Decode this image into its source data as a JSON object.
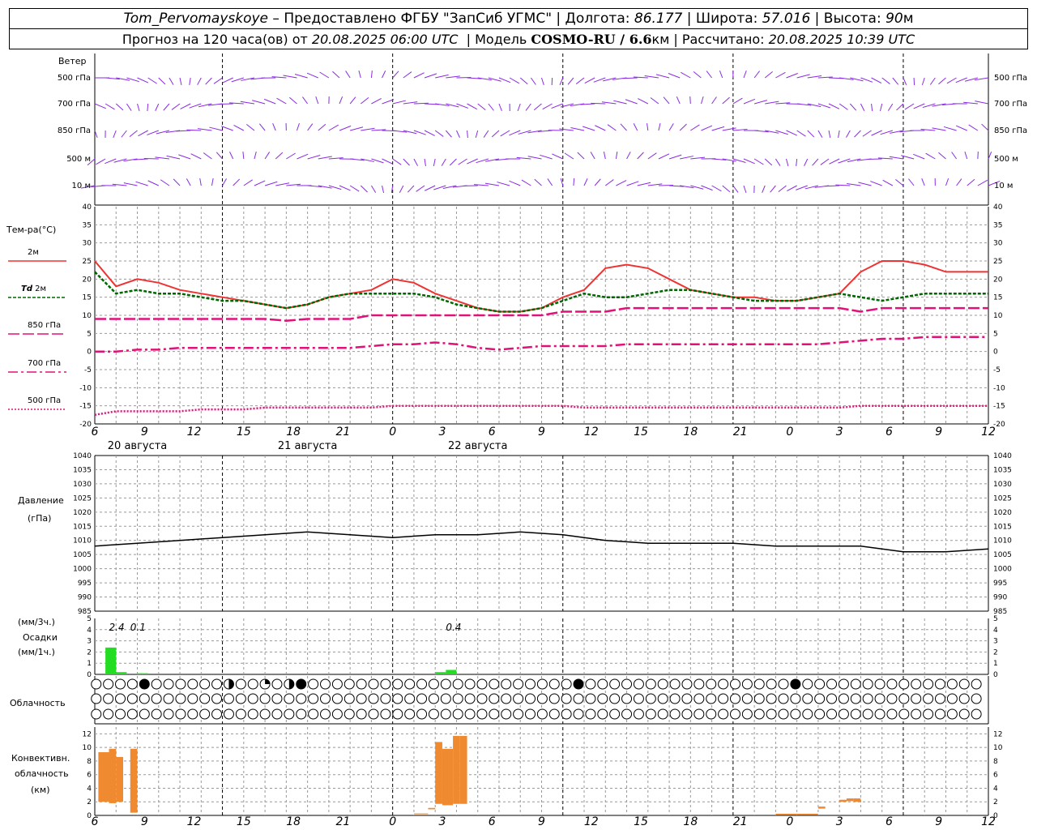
{
  "header": {
    "station": "Tom_Pervomayskoye",
    "provider": " – Предоставлено ФГБУ \"ЗапСиб УГМС\" | ",
    "lon_label": "Долгота: ",
    "lon": "86.177",
    "lat_label": " | Широта: ",
    "lat": "57.016",
    "alt_label": " | Высота: ",
    "alt": "90",
    "alt_unit": "м",
    "forecast_label": "Прогноз на 120 часа(ов) от ",
    "forecast_from": "20.08.2025 06:00 UTC",
    "model_label": "  | Модель ",
    "model": "COSMO-RU / 6.6",
    "model_unit": "км",
    "calc_label": " | Рассчитано: ",
    "calc_time": "20.08.2025 10:39 UTC"
  },
  "colors": {
    "wind": "#8a2be2",
    "t2m": "#ee3333",
    "td2m": "#006600",
    "t850": "#e0127a",
    "t700": "#e0127a",
    "t500": "#e0127a",
    "pressure": "#000000",
    "precip": "#22dd22",
    "conv": "#f08a30"
  },
  "wind_panel": {
    "title": "Ветер",
    "levels": [
      "500 гПа",
      "700 гПа",
      "850 гПа",
      "500 м",
      "10 м"
    ]
  },
  "temp_panel": {
    "title": "Тем-ра(°C)",
    "legend": [
      {
        "key": "t2m",
        "label": "2м"
      },
      {
        "key": "td2m",
        "label_bold": "Td",
        "label": " 2м"
      },
      {
        "key": "t850",
        "label": "850 гПа"
      },
      {
        "key": "t700",
        "label": "700 гПа"
      },
      {
        "key": "t500",
        "label": "500 гПа"
      }
    ]
  },
  "pressure_panel": {
    "title1": "Давление",
    "title2": "(гПа)"
  },
  "precip_panel": {
    "title1": "(мм/3ч.)",
    "title2": "Осадки",
    "title3": "(мм/1ч.)"
  },
  "cloud_panel": {
    "title": "Облачность"
  },
  "conv_panel": {
    "title1": "Конвективн.",
    "title2": "облачность",
    "title3": "(км)"
  },
  "x_ticks": [
    "6",
    "9",
    "12",
    "15",
    "18",
    "21",
    "0",
    "3",
    "6",
    "9",
    "12",
    "15",
    "18",
    "21",
    "0",
    "3",
    "6",
    "9",
    "12"
  ],
  "dates": [
    "20 августа",
    "21 августа",
    "22 августа"
  ],
  "chart_data": [
    {
      "type": "line",
      "panel": "temperature",
      "ylim": [
        -20,
        40
      ],
      "yticks": [
        -20,
        -15,
        -10,
        -5,
        0,
        5,
        10,
        15,
        20,
        25,
        30,
        35,
        40
      ],
      "x_hours": [
        0,
        3,
        6,
        9,
        12,
        15,
        18,
        21,
        24,
        27,
        30,
        33,
        36,
        39,
        42,
        45,
        48,
        51,
        54,
        57,
        60,
        63,
        66,
        69,
        72,
        75,
        78,
        81,
        84,
        87,
        90,
        93,
        96,
        99,
        102,
        105,
        108,
        111,
        114,
        117,
        120,
        123,
        126
      ],
      "series": [
        {
          "key": "t2m",
          "values": [
            25,
            18,
            20,
            19,
            17,
            16,
            15,
            14,
            13,
            12,
            13,
            15,
            16,
            17,
            20,
            19,
            16,
            14,
            12,
            11,
            11,
            12,
            15,
            17,
            23,
            24,
            23,
            20,
            17,
            16,
            15,
            15,
            14,
            14,
            15,
            16,
            22,
            25,
            25,
            24,
            22,
            22,
            22
          ]
        },
        {
          "key": "td2m",
          "values": [
            22,
            16,
            17,
            16,
            16,
            15,
            14,
            14,
            13,
            12,
            13,
            15,
            16,
            16,
            16,
            16,
            15,
            13,
            12,
            11,
            11,
            12,
            14,
            16,
            15,
            15,
            16,
            17,
            17,
            16,
            15,
            14,
            14,
            14,
            15,
            16,
            15,
            14,
            15,
            16,
            16,
            16,
            16
          ]
        },
        {
          "key": "t850",
          "values": [
            9,
            9,
            9,
            9,
            9,
            9,
            9,
            9,
            9,
            8.5,
            9,
            9,
            9,
            10,
            10,
            10,
            10,
            10,
            10,
            10,
            10,
            10,
            11,
            11,
            11,
            12,
            12,
            12,
            12,
            12,
            12,
            12,
            12,
            12,
            12,
            12,
            11,
            12,
            12,
            12,
            12,
            12,
            12
          ]
        },
        {
          "key": "t700",
          "values": [
            0,
            0,
            0.5,
            0.5,
            1,
            1,
            1,
            1,
            1,
            1,
            1,
            1,
            1,
            1.5,
            2,
            2,
            2.5,
            2,
            1,
            0.5,
            1,
            1.5,
            1.5,
            1.5,
            1.5,
            2,
            2,
            2,
            2,
            2,
            2,
            2,
            2,
            2,
            2,
            2.5,
            3,
            3.5,
            3.5,
            4,
            4,
            4,
            4
          ]
        },
        {
          "key": "t500",
          "values": [
            -17.5,
            -16.5,
            -16.5,
            -16.5,
            -16.5,
            -16,
            -16,
            -16,
            -15.5,
            -15.5,
            -15.5,
            -15.5,
            -15.5,
            -15.5,
            -15,
            -15,
            -15,
            -15,
            -15,
            -15,
            -15,
            -15,
            -15,
            -15.5,
            -15.5,
            -15.5,
            -15.5,
            -15.5,
            -15.5,
            -15.5,
            -15.5,
            -15.5,
            -15.5,
            -15.5,
            -15.5,
            -15.5,
            -15,
            -15,
            -15,
            -15,
            -15,
            -15,
            -15
          ]
        }
      ]
    },
    {
      "type": "line",
      "panel": "pressure",
      "ylim": [
        985,
        1040
      ],
      "yticks": [
        985,
        990,
        995,
        1000,
        1005,
        1010,
        1015,
        1020,
        1025,
        1030,
        1035,
        1040
      ],
      "x_hours": [
        0,
        6,
        12,
        18,
        24,
        30,
        36,
        42,
        48,
        54,
        60,
        66,
        72,
        78,
        84,
        90,
        96,
        102,
        108,
        114,
        120,
        126
      ],
      "series": [
        {
          "key": "pressure",
          "values": [
            1008,
            1009,
            1010,
            1011,
            1012,
            1013,
            1012,
            1011,
            1012,
            1012,
            1013,
            1012,
            1010,
            1009,
            1009,
            1009,
            1008,
            1008,
            1008,
            1006,
            1006,
            1007
          ]
        }
      ]
    },
    {
      "type": "bar",
      "panel": "precipitation",
      "ylim": [
        0,
        5
      ],
      "yticks": [
        0,
        1,
        2,
        3,
        4,
        5
      ],
      "bars": [
        {
          "start_h": 1.5,
          "end_h": 3,
          "value": 2.4
        },
        {
          "start_h": 3,
          "end_h": 4.5,
          "value": 0.2
        },
        {
          "start_h": 6,
          "end_h": 7.5,
          "value": 0.1
        },
        {
          "start_h": 48,
          "end_h": 49.5,
          "value": 0.2
        },
        {
          "start_h": 49.5,
          "end_h": 51,
          "value": 0.4
        }
      ],
      "labels": [
        {
          "hour": 2,
          "text": "2.4"
        },
        {
          "hour": 5,
          "text": "0.1"
        },
        {
          "hour": 49.5,
          "text": "0.4"
        }
      ]
    },
    {
      "type": "bar",
      "panel": "convective_cloud",
      "ylim": [
        0,
        13
      ],
      "yticks": [
        0,
        2,
        4,
        6,
        8,
        10,
        12
      ],
      "bars": [
        {
          "start_h": 0.5,
          "end_h": 2,
          "base": 2,
          "top": 9.3
        },
        {
          "start_h": 2,
          "end_h": 3,
          "base": 1.8,
          "top": 9.8
        },
        {
          "start_h": 3,
          "end_h": 4,
          "base": 2,
          "top": 8.6
        },
        {
          "start_h": 5,
          "end_h": 6,
          "base": 0.4,
          "top": 9.8
        },
        {
          "start_h": 45,
          "end_h": 47,
          "base": 0.2,
          "top": 0.3
        },
        {
          "start_h": 47,
          "end_h": 48,
          "base": 0.9,
          "top": 1.1
        },
        {
          "start_h": 48,
          "end_h": 49,
          "base": 1.7,
          "top": 10.8
        },
        {
          "start_h": 49,
          "end_h": 50.5,
          "base": 1.5,
          "top": 9.8
        },
        {
          "start_h": 50.5,
          "end_h": 51.5,
          "base": 1.7,
          "top": 11.7
        },
        {
          "start_h": 51.5,
          "end_h": 52.5,
          "base": 1.7,
          "top": 11.7
        },
        {
          "start_h": 96,
          "end_h": 102,
          "base": 0.1,
          "top": 0.25
        },
        {
          "start_h": 102,
          "end_h": 103,
          "base": 1,
          "top": 1.3
        },
        {
          "start_h": 105,
          "end_h": 106,
          "base": 2,
          "top": 2.3
        },
        {
          "start_h": 106,
          "end_h": 107,
          "base": 2.1,
          "top": 2.5
        },
        {
          "start_h": 107,
          "end_h": 108,
          "base": 2,
          "top": 2.5
        }
      ]
    },
    {
      "type": "table",
      "panel": "cloudiness",
      "rows": [
        "00002000000100301200000000000000000000002000000000000000002000000000000000",
        "00000000000000000000000000000000000000000000000000000000000000000000000000",
        "00000000000000000000000000000000000000000000000000000000000000000000000000"
      ]
    }
  ]
}
